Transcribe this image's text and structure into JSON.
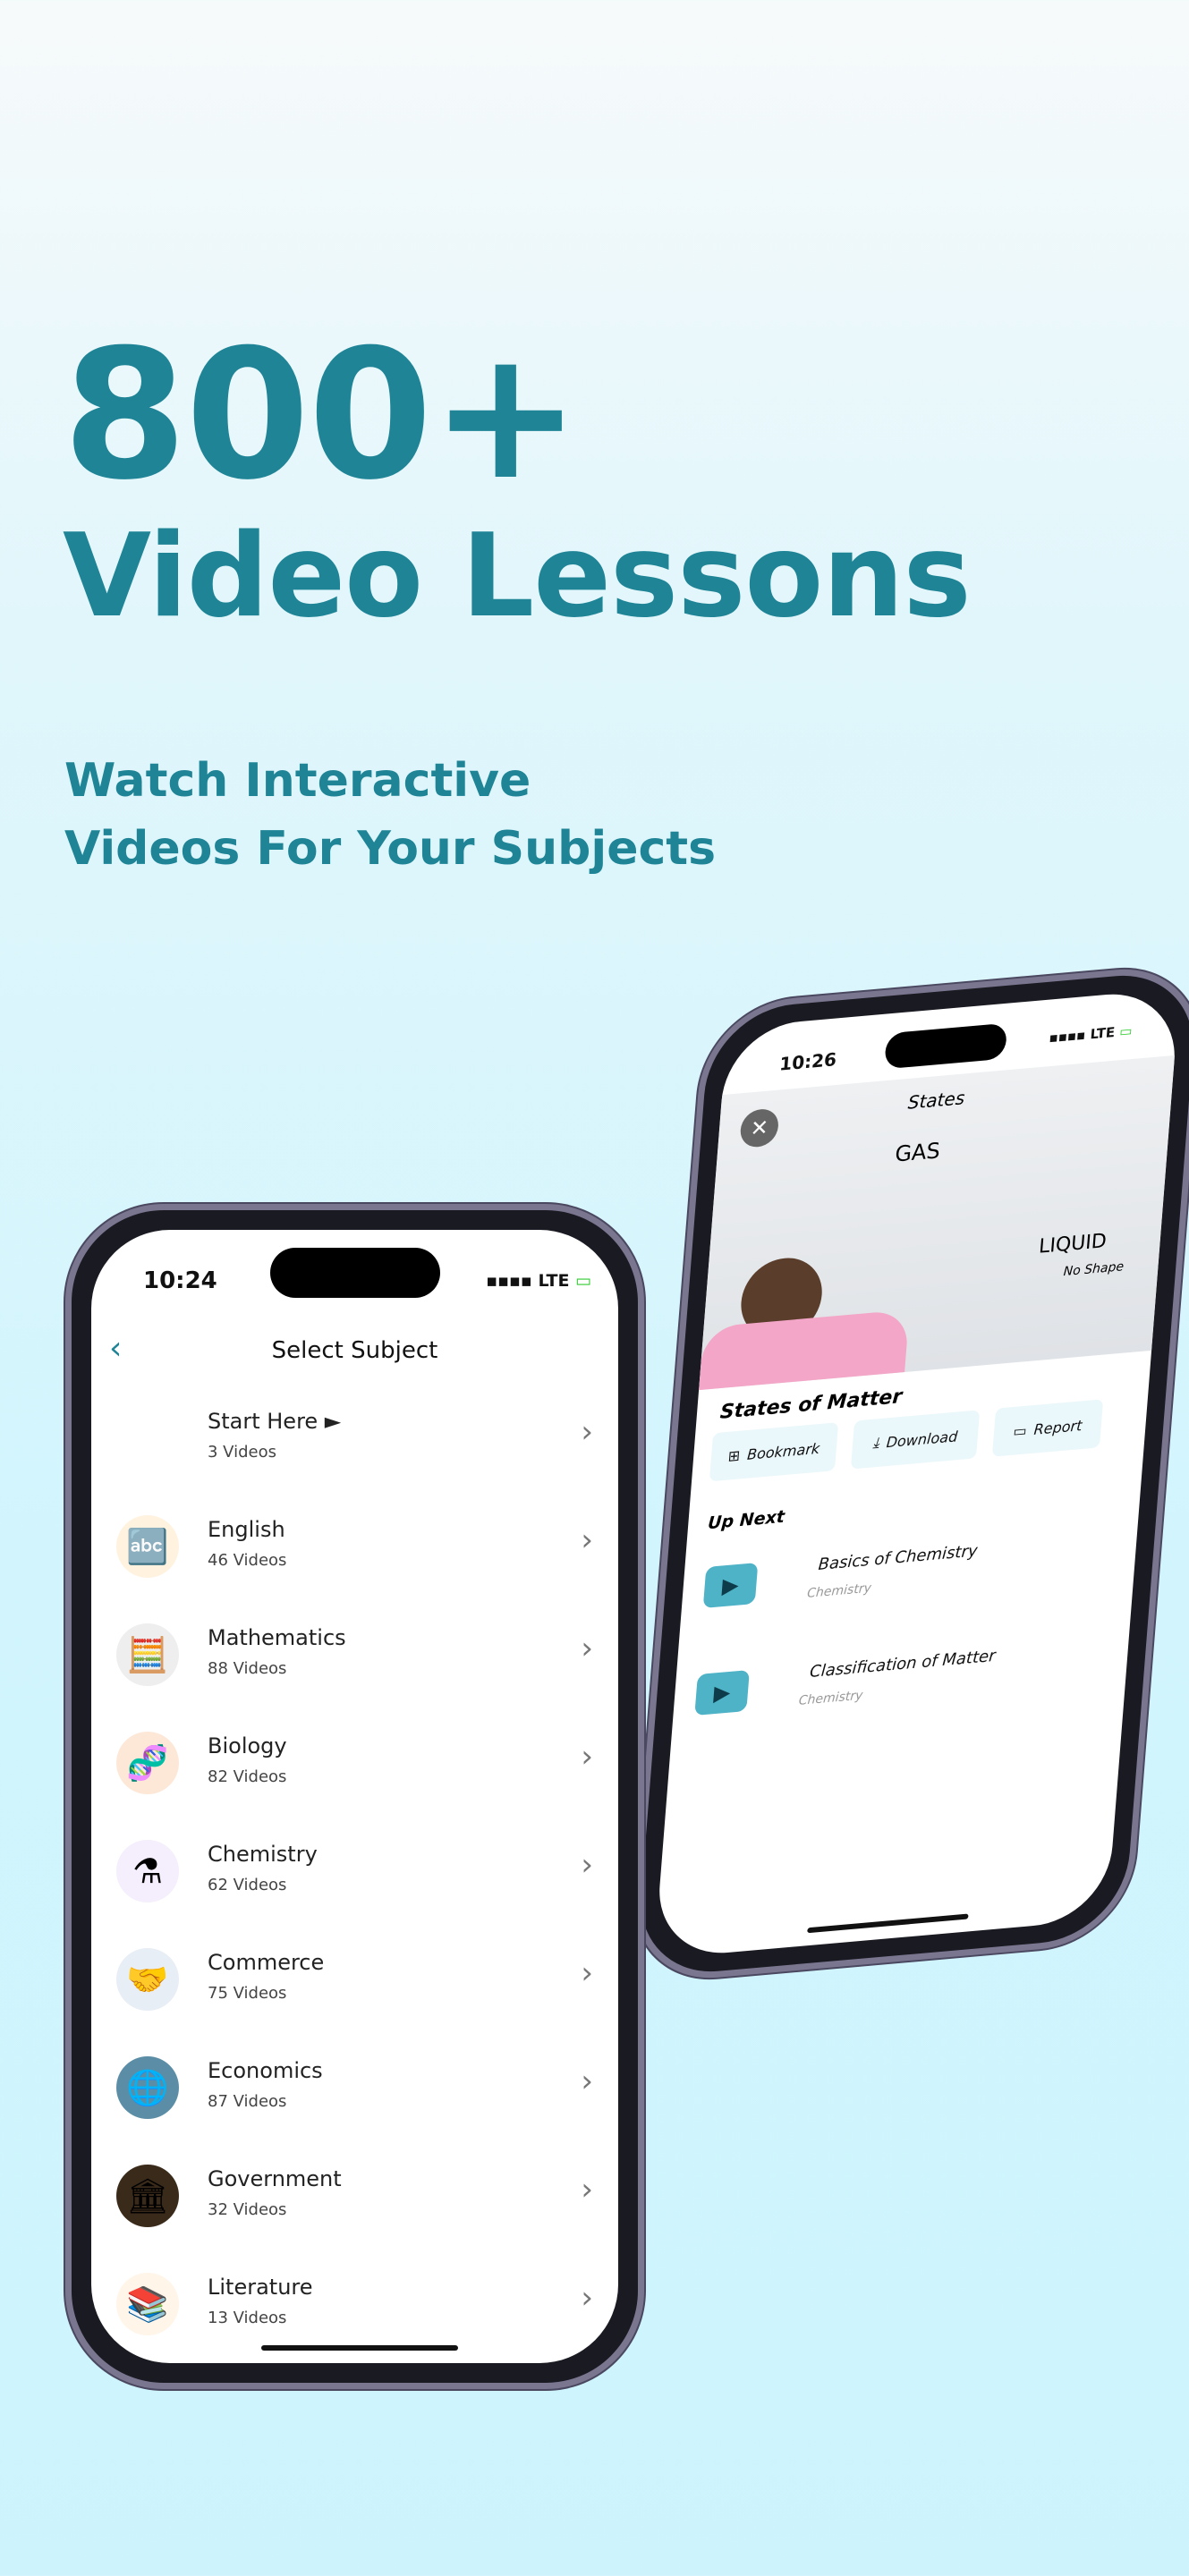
{
  "hero": {
    "headline_1": "800+",
    "headline_2": "Video Lessons",
    "subtitle_1": "Watch Interactive",
    "subtitle_2": "Videos For Your Subjects"
  },
  "colors": {
    "brand": "#1e8496",
    "background": "#d2f5fd"
  },
  "left_phone": {
    "status": {
      "time": "10:24",
      "network": "LTE"
    },
    "header": {
      "title": "Select Subject",
      "back_icon": "chevron-left-icon"
    },
    "subjects": [
      {
        "name": "Start Here ►",
        "count": "3 Videos",
        "icon": ""
      },
      {
        "name": "English",
        "count": "46 Videos",
        "icon": "🔤"
      },
      {
        "name": "Mathematics",
        "count": "88 Videos",
        "icon": "🧮"
      },
      {
        "name": "Biology",
        "count": "82 Videos",
        "icon": "🧬"
      },
      {
        "name": "Chemistry",
        "count": "62 Videos",
        "icon": "⚗"
      },
      {
        "name": "Commerce",
        "count": "75 Videos",
        "icon": "🤝"
      },
      {
        "name": "Economics",
        "count": "87 Videos",
        "icon": "🌐"
      },
      {
        "name": "Government",
        "count": "32 Videos",
        "icon": "🏛"
      },
      {
        "name": "Literature",
        "count": "13 Videos",
        "icon": "📚"
      }
    ]
  },
  "right_phone": {
    "status": {
      "time": "10:26",
      "network": "LTE"
    },
    "video": {
      "board_1": "States",
      "board_2": "GAS",
      "board_3": "LIQUID",
      "board_4": "No Shape"
    },
    "title": "States of Matter",
    "actions": [
      {
        "label": "Bookmark",
        "icon": "⊞"
      },
      {
        "label": "Download",
        "icon": "⤓"
      },
      {
        "label": "Report",
        "icon": "▭"
      }
    ],
    "up_next_label": "Up Next",
    "up_next": [
      {
        "title": "Basics of Chemistry",
        "subject": "Chemistry"
      },
      {
        "title": "Classification of Matter",
        "subject": "Chemistry"
      }
    ]
  }
}
